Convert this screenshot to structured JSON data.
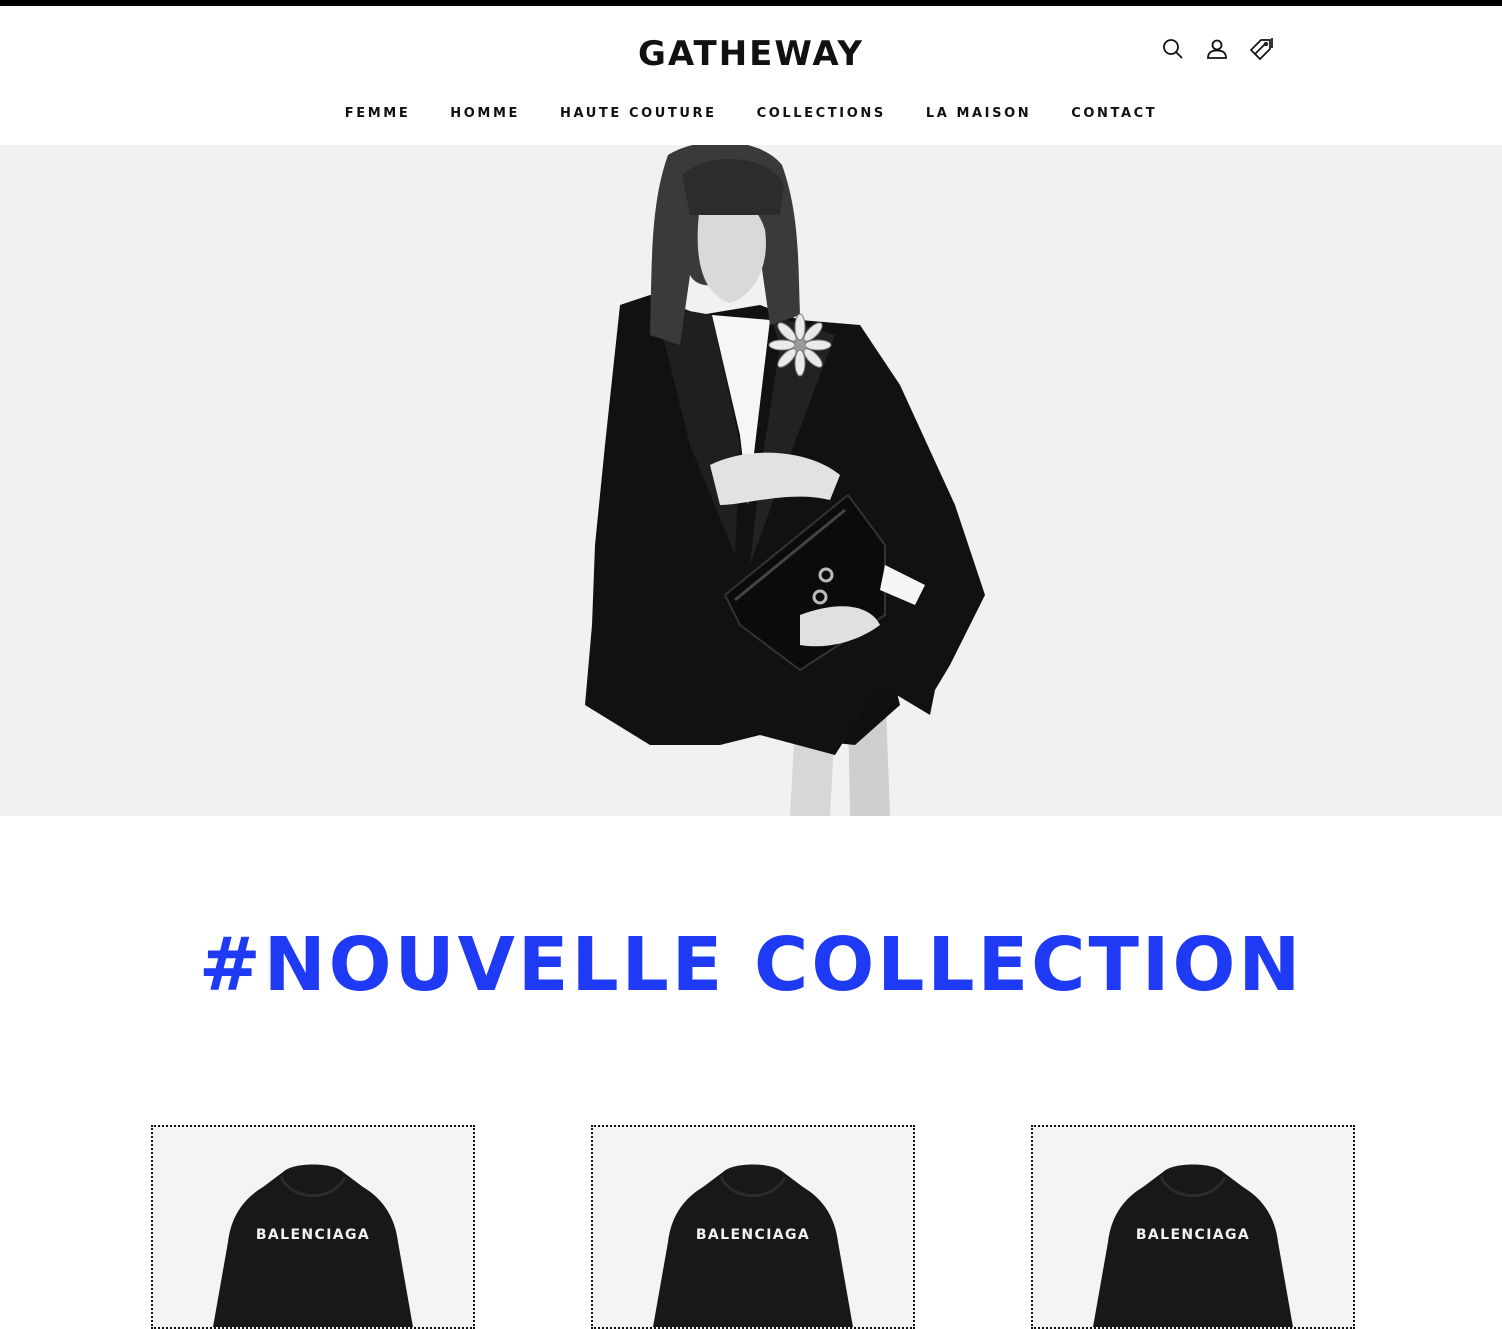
{
  "brand": {
    "name": "GATHEWAY"
  },
  "header_icons": [
    {
      "name": "search-icon"
    },
    {
      "name": "user-icon"
    },
    {
      "name": "tag-icon"
    }
  ],
  "nav": {
    "items": [
      "FEMME",
      "HOMME",
      "HAUTE COUTURE",
      "COLLECTIONS",
      "LA MAISON",
      "CONTACT"
    ]
  },
  "hero": {
    "background": "#f1f1f1"
  },
  "section": {
    "title": "#NOUVELLE COLLECTION",
    "title_color": "#1f3af5"
  },
  "products": [
    {
      "print": "BALENCIAGA"
    },
    {
      "print": "BALENCIAGA"
    },
    {
      "print": "BALENCIAGA"
    }
  ]
}
